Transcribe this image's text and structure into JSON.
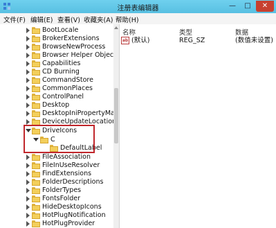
{
  "window": {
    "title": "注册表编辑器"
  },
  "title_buttons": {
    "minimize": "—",
    "maximize": "□",
    "close": "✕"
  },
  "menu": [
    "文件(F)",
    "编辑(E)",
    "查看(V)",
    "收藏夹(A)",
    "帮助(H)"
  ],
  "tree": {
    "items": [
      {
        "label": "BootLocale"
      },
      {
        "label": "BrokerExtensions"
      },
      {
        "label": "BrowseNewProcess"
      },
      {
        "label": "Browser Helper Objects"
      },
      {
        "label": "Capabilities"
      },
      {
        "label": "CD Burning"
      },
      {
        "label": "CommandStore"
      },
      {
        "label": "CommonPlaces"
      },
      {
        "label": "ControlPanel"
      },
      {
        "label": "Desktop"
      },
      {
        "label": "DesktopIniPropertyMap"
      },
      {
        "label": "DeviceUpdateLocations"
      },
      {
        "label": "DriveIcons"
      },
      {
        "label": "C"
      },
      {
        "label": "DefaultLabel"
      },
      {
        "label": "FileAssociation"
      },
      {
        "label": "FileInUseResolver"
      },
      {
        "label": "FindExtensions"
      },
      {
        "label": "FolderDescriptions"
      },
      {
        "label": "FolderTypes"
      },
      {
        "label": "FontsFolder"
      },
      {
        "label": "HideDesktopIcons"
      },
      {
        "label": "HotPlugNotification"
      },
      {
        "label": "HotPlugProvider"
      }
    ]
  },
  "list": {
    "columns": [
      "名称",
      "类型",
      "数据"
    ],
    "rows": [
      {
        "icon": "ab",
        "name": "(默认)",
        "type": "REG_SZ",
        "data": "(数值未设置)"
      }
    ]
  }
}
